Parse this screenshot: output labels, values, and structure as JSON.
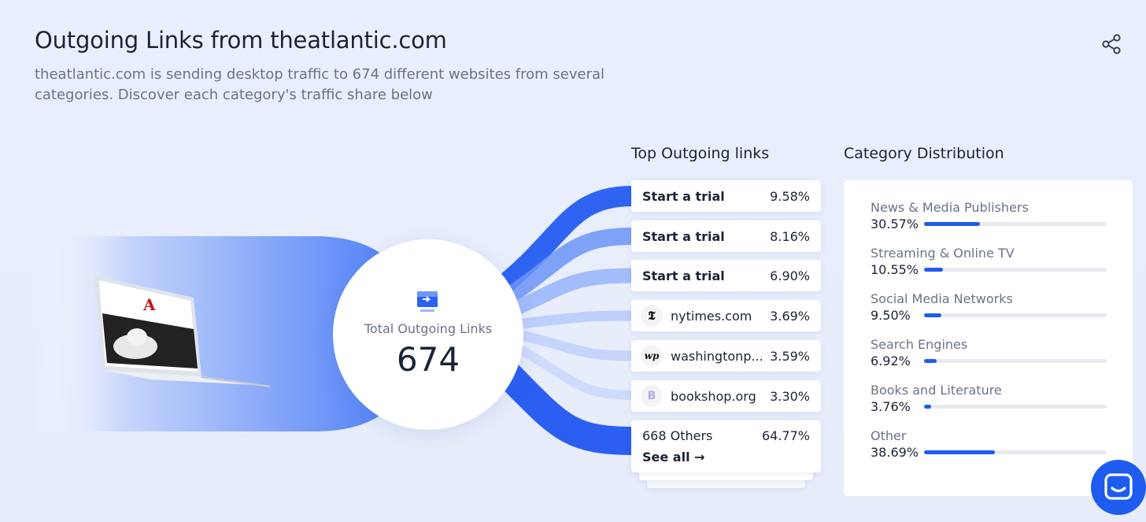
{
  "header": {
    "title": "Outgoing Links from theatlantic.com",
    "subtitle": "theatlantic.com is sending desktop traffic to 674 different websites from several categories. Discover each category's traffic share below"
  },
  "center": {
    "label": "Total Outgoing Links",
    "value": "674"
  },
  "top_links": {
    "title": "Top Outgoing links",
    "items": [
      {
        "label": "Start a trial",
        "pct": "9.58%",
        "icon": "none"
      },
      {
        "label": "Start a trial",
        "pct": "8.16%",
        "icon": "none"
      },
      {
        "label": "Start a trial",
        "pct": "6.90%",
        "icon": "none"
      },
      {
        "label": "nytimes.com",
        "pct": "3.69%",
        "icon": "nytimes-icon",
        "glyph": "𝕿"
      },
      {
        "label": "washingtonp...",
        "pct": "3.59%",
        "icon": "washingtonpost-icon",
        "glyph": "wp"
      },
      {
        "label": "bookshop.org",
        "pct": "3.30%",
        "icon": "bookshop-icon",
        "glyph": "B"
      }
    ],
    "others": {
      "label": "668 Others",
      "pct": "64.77%",
      "see_all": "See all →"
    }
  },
  "categories": {
    "title": "Category Distribution",
    "items": [
      {
        "name": "News & Media Publishers",
        "pct": "30.57%",
        "value": 30.57
      },
      {
        "name": "Streaming & Online TV",
        "pct": "10.55%",
        "value": 10.55
      },
      {
        "name": "Social Media Networks",
        "pct": "9.50%",
        "value": 9.5
      },
      {
        "name": "Search Engines",
        "pct": "6.92%",
        "value": 6.92
      },
      {
        "name": "Books and Literature",
        "pct": "3.76%",
        "value": 3.76
      },
      {
        "name": "Other",
        "pct": "38.69%",
        "value": 38.69
      }
    ],
    "bar_scale_max": 100
  },
  "colors": {
    "accent": "#1e5cf0",
    "flow": "#3e72f5",
    "text": "#1b2337",
    "muted": "#6a7388"
  }
}
